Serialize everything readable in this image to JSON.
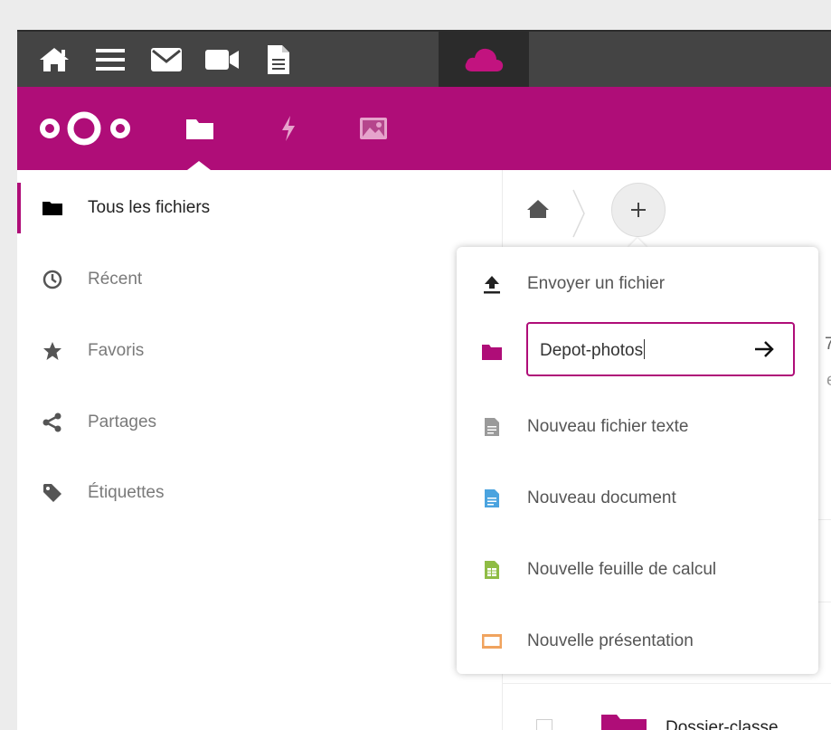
{
  "colors": {
    "brand": "#af0d78",
    "topbar": "#444444",
    "topbar_active": "#2b2b2b"
  },
  "topbar": {
    "icons": [
      "home-icon",
      "menu-icon",
      "mail-icon",
      "video-icon",
      "document-icon",
      "cloud-icon"
    ],
    "active": "cloud-icon"
  },
  "header": {
    "logo": "nextcloud-logo",
    "apps": [
      "files-icon",
      "activity-icon",
      "gallery-icon"
    ],
    "active_app": "files-icon"
  },
  "sidebar": {
    "items": [
      {
        "label": "Tous les fichiers",
        "icon": "folder-icon",
        "active": true
      },
      {
        "label": "Récent",
        "icon": "clock-icon",
        "active": false
      },
      {
        "label": "Favoris",
        "icon": "star-icon",
        "active": false
      },
      {
        "label": "Partages",
        "icon": "share-icon",
        "active": false
      },
      {
        "label": "Étiquettes",
        "icon": "tag-icon",
        "active": false
      }
    ]
  },
  "breadcrumb": {
    "home": "home-icon",
    "add": "+"
  },
  "new_menu": {
    "upload": "Envoyer un fichier",
    "new_folder_value": "Depot-photos",
    "new_text_file": "Nouveau fichier texte",
    "new_document": "Nouveau document",
    "new_spreadsheet": "Nouvelle feuille de calcul",
    "new_presentation": "Nouvelle présentation"
  },
  "file_list": {
    "partial_text_1": "7",
    "partial_text_2": "e",
    "rows": [
      {
        "name": "Dossier-classe",
        "type": "folder"
      }
    ]
  }
}
